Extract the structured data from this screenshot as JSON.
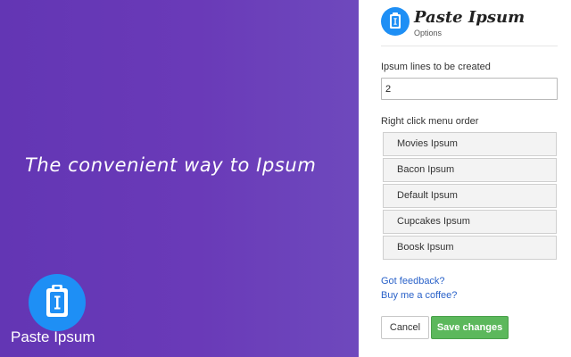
{
  "colors": {
    "accent_purple": "#6336b4",
    "accent_blue": "#1e8ff5",
    "save_green": "#5cb85c",
    "link_blue": "#2a62c9"
  },
  "hero": {
    "tagline": "The convenient way to Ipsum",
    "app_name": "Paste Ipsum",
    "logo_icon": "clipboard-icon"
  },
  "header": {
    "title": "Paste Ipsum",
    "subtitle": "Options",
    "logo_icon": "clipboard-icon"
  },
  "form": {
    "lines_label": "Ipsum lines to be created",
    "lines_value": "2",
    "menu_order_label": "Right click menu order",
    "menu_items": [
      {
        "label": "Movies Ipsum"
      },
      {
        "label": "Bacon Ipsum"
      },
      {
        "label": "Default Ipsum"
      },
      {
        "label": "Cupcakes Ipsum"
      },
      {
        "label": "Boosk Ipsum"
      }
    ]
  },
  "links": {
    "feedback": "Got feedback?",
    "coffee": "Buy me a coffee?"
  },
  "buttons": {
    "cancel": "Cancel",
    "save": "Save changes"
  }
}
